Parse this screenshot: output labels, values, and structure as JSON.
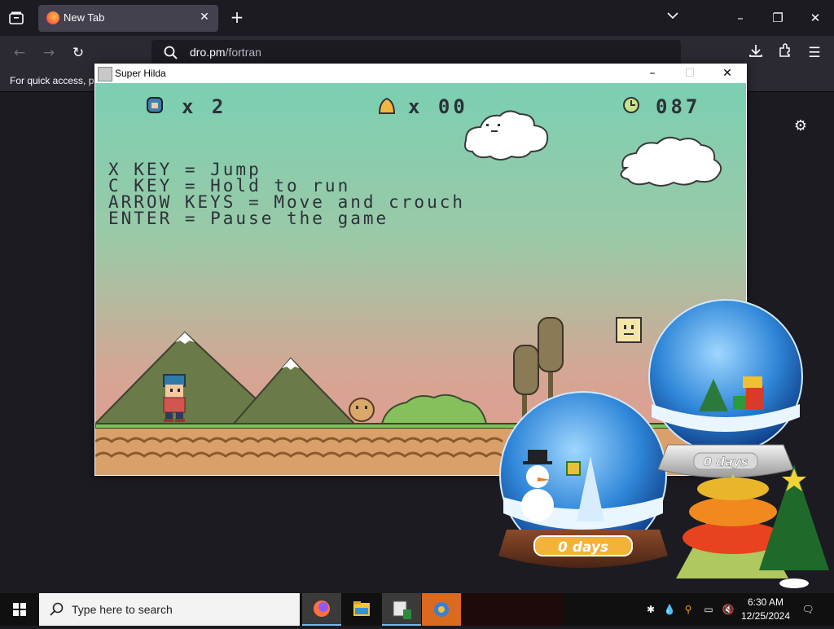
{
  "browser": {
    "tab_title": "New Tab",
    "url_host": "dro.pm",
    "url_path": "/fortran",
    "bookmark_hint": "For quick access, pla"
  },
  "game_window": {
    "title": "Super Hilda",
    "hud": {
      "lives": "x 2",
      "bells": "x 00",
      "time": "087"
    },
    "instructions": [
      "X KEY = Jump",
      "C KEY = Hold to run",
      "ARROW KEYS = Move and crouch",
      "ENTER = Pause the game"
    ]
  },
  "widgets": {
    "globe_small_label": "0 days",
    "globe_large_label": "0 days"
  },
  "taskbar": {
    "search_placeholder": "Type here to search",
    "time": "6:30 AM",
    "date": "12/25/2024"
  },
  "colors": {
    "browser_bg": "#1c1b22",
    "toolbar_bg": "#2b2a33",
    "sky_top": "#7bcfb2",
    "sky_bottom": "#e39a8e",
    "ground": "#d9a06a",
    "grass": "#7fbf5a"
  }
}
